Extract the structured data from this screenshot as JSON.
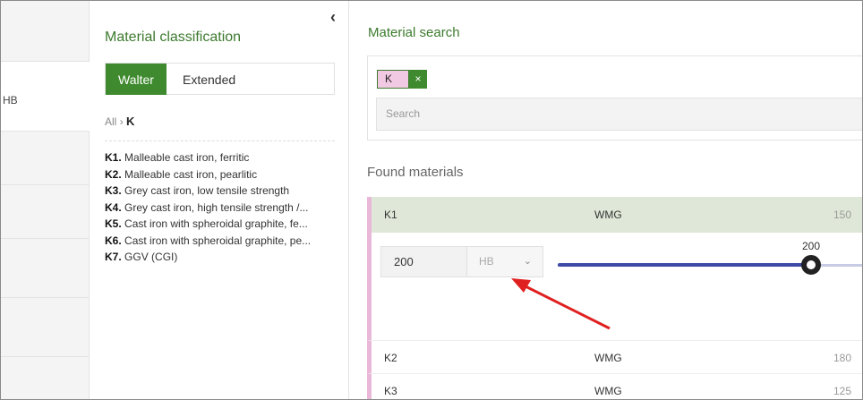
{
  "sidebar_left": {
    "unit_label": "HB"
  },
  "classification": {
    "title": "Material classification",
    "collapse_icon": "‹",
    "tabs": [
      {
        "label": "Walter",
        "active": true
      },
      {
        "label": "Extended",
        "active": false
      }
    ],
    "breadcrumb": {
      "root": "All",
      "separator": "›",
      "current": "K"
    },
    "materials": [
      {
        "code": "K1.",
        "name": "Malleable cast iron, ferritic"
      },
      {
        "code": "K2.",
        "name": "Malleable cast iron, pearlitic"
      },
      {
        "code": "K3.",
        "name": "Grey cast iron, low tensile strength"
      },
      {
        "code": "K4.",
        "name": "Grey cast iron, high tensile strength /..."
      },
      {
        "code": "K5.",
        "name": "Cast iron with spheroidal graphite, fe..."
      },
      {
        "code": "K6.",
        "name": "Cast iron with spheroidal graphite, pe..."
      },
      {
        "code": "K7.",
        "name": "GGV (CGI)"
      }
    ]
  },
  "search": {
    "title": "Material search",
    "chip_label": "K",
    "chip_close": "×",
    "placeholder": "Search"
  },
  "found": {
    "title": "Found materials",
    "rows": [
      {
        "code": "K1",
        "standard": "WMG",
        "value": "150"
      },
      {
        "code": "K2",
        "standard": "WMG",
        "value": "180"
      },
      {
        "code": "K3",
        "standard": "WMG",
        "value": "125"
      }
    ],
    "expanded": {
      "hardness_value": "200",
      "unit": "HB",
      "chevron": "⌄",
      "slider_label": "200",
      "slider_fraction": 0.82
    }
  },
  "colors": {
    "accent_green": "#3f8a2e",
    "chip_pink": "#f2c9e2",
    "slider_blue": "#3e4ba6",
    "annotation_red": "#e02020"
  }
}
